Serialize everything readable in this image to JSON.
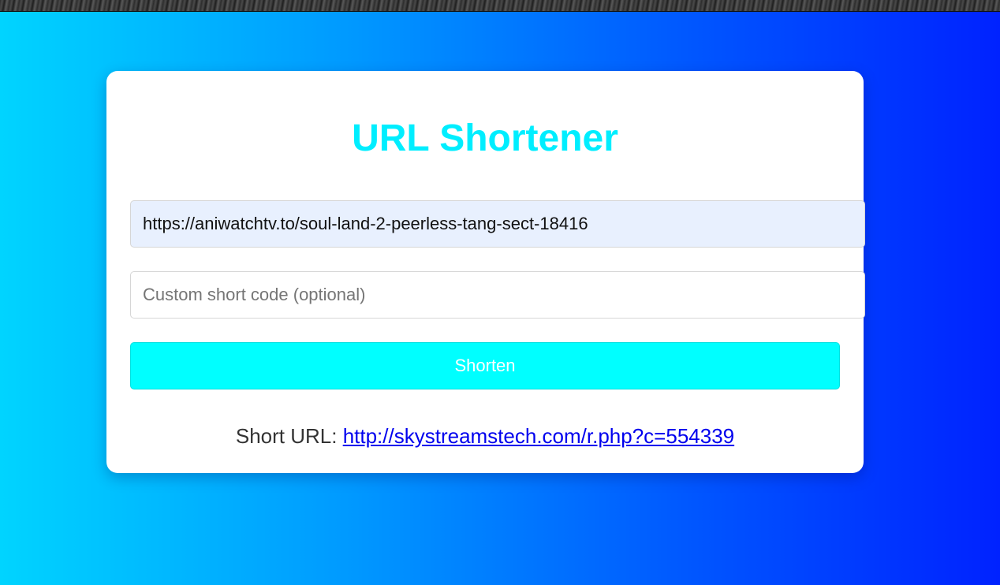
{
  "page": {
    "title": "URL Shortener"
  },
  "form": {
    "url_value": "https://aniwatchtv.to/soul-land-2-peerless-tang-sect-18416",
    "custom_code_placeholder": "Custom short code (optional)",
    "custom_code_value": "",
    "shorten_label": "Shorten"
  },
  "result": {
    "label": "Short URL: ",
    "short_url": "http://skystreamstech.com/r.php?c=554339"
  },
  "colors": {
    "title": "#00eeff",
    "button_bg": "#00ffff",
    "link": "#0000ee",
    "url_field_bg": "#e8f0fe"
  }
}
